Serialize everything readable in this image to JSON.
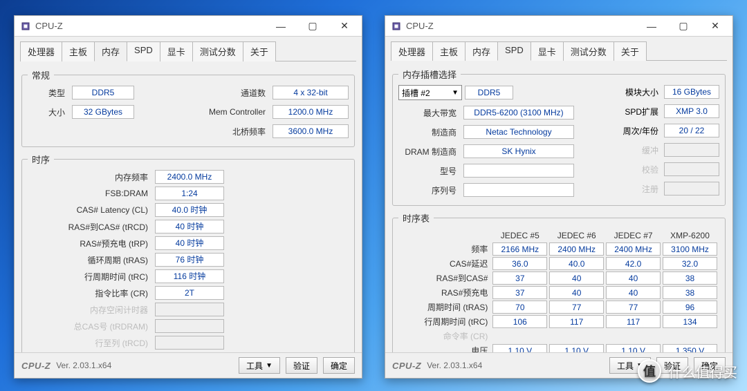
{
  "app_title": "CPU-Z",
  "tabs": [
    "处理器",
    "主板",
    "内存",
    "SPD",
    "显卡",
    "测试分数",
    "关于"
  ],
  "left": {
    "active_tab_index": 2,
    "general_legend": "常规",
    "timing_legend": "时序",
    "general": {
      "type_label": "类型",
      "type": "DDR5",
      "size_label": "大小",
      "size": "32 GBytes",
      "channels_label": "通道数",
      "channels": "4 x 32-bit",
      "memctrl_label": "Mem Controller",
      "memctrl": "1200.0 MHz",
      "nb_label": "北桥频率",
      "nb": "3600.0 MHz"
    },
    "timing": [
      {
        "label": "内存频率",
        "value": "2400.0 MHz"
      },
      {
        "label": "FSB:DRAM",
        "value": "1:24"
      },
      {
        "label": "CAS# Latency (CL)",
        "value": "40.0 时钟"
      },
      {
        "label": "RAS#到CAS# (tRCD)",
        "value": "40 时钟"
      },
      {
        "label": "RAS#预充电 (tRP)",
        "value": "40 时钟"
      },
      {
        "label": "循环周期 (tRAS)",
        "value": "76 时钟"
      },
      {
        "label": "行周期时间 (tRC)",
        "value": "116 时钟"
      },
      {
        "label": "指令比率 (CR)",
        "value": "2T"
      },
      {
        "label": "内存空闲计时器",
        "value": "",
        "disabled": true
      },
      {
        "label": "总CAS号 (tRDRAM)",
        "value": "",
        "disabled": true
      },
      {
        "label": "行至列 (tRCD)",
        "value": "",
        "disabled": true
      }
    ]
  },
  "right": {
    "active_tab_index": 3,
    "slot_legend": "内存插槽选择",
    "timing_legend": "时序表",
    "slot_label": "插槽 #2",
    "top": {
      "type": "DDR5",
      "bw_label": "最大带宽",
      "bw": "DDR5-6200 (3100 MHz)",
      "mfr_label": "制造商",
      "mfr": "Netac Technology",
      "dram_label": "DRAM 制造商",
      "dram": "SK Hynix",
      "pn_label": "型号",
      "pn": "",
      "sn_label": "序列号",
      "sn": "",
      "size_label": "模块大小",
      "size": "16 GBytes",
      "ext_label": "SPD扩展",
      "ext": "XMP 3.0",
      "wy_label": "周次/年份",
      "wy": "20 / 22",
      "buf_label": "缓冲",
      "ecc_label": "校验",
      "reg_label": "注册"
    },
    "table": {
      "cols": [
        "JEDEC #5",
        "JEDEC #6",
        "JEDEC #7",
        "XMP-6200"
      ],
      "rows": [
        {
          "label": "频率",
          "v": [
            "2166 MHz",
            "2400 MHz",
            "2400 MHz",
            "3100 MHz"
          ]
        },
        {
          "label": "CAS#延迟",
          "v": [
            "36.0",
            "40.0",
            "42.0",
            "32.0"
          ]
        },
        {
          "label": "RAS#到CAS#",
          "v": [
            "37",
            "40",
            "40",
            "38"
          ]
        },
        {
          "label": "RAS#预充电",
          "v": [
            "37",
            "40",
            "40",
            "38"
          ]
        },
        {
          "label": "周期时间 (tRAS)",
          "v": [
            "70",
            "77",
            "77",
            "96"
          ]
        },
        {
          "label": "行周期时间 (tRC)",
          "v": [
            "106",
            "117",
            "117",
            "134"
          ]
        },
        {
          "label": "命令率 (CR)",
          "v": [
            "",
            "",
            "",
            ""
          ],
          "disabled": true
        },
        {
          "label": "电压",
          "v": [
            "1.10 V",
            "1.10 V",
            "1.10 V",
            "1.350 V"
          ]
        }
      ]
    }
  },
  "footer": {
    "logo": "CPU-Z",
    "version": "Ver. 2.03.1.x64",
    "tools": "工具",
    "validate": "验证",
    "ok": "确定"
  },
  "watermark": "什么值得买"
}
